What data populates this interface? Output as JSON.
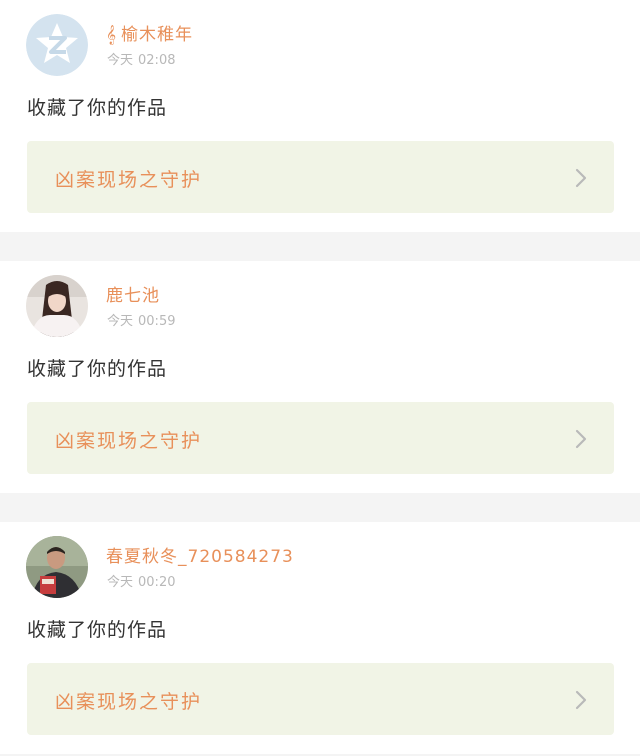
{
  "notifications": [
    {
      "user_prefix": "𝄞",
      "username": "榆木稚年",
      "time_day": "今天",
      "time_clock": "02:08",
      "action": "收藏了你的作品",
      "work_title": "凶案现场之守护",
      "avatar": "qq-default-avatar"
    },
    {
      "user_prefix": "",
      "username": "鹿七池",
      "time_day": "今天",
      "time_clock": "00:59",
      "action": "收藏了你的作品",
      "work_title": "凶案现场之守护",
      "avatar": "user-photo-avatar"
    },
    {
      "user_prefix": "",
      "username": "春夏秋冬_720584273",
      "time_day": "今天",
      "time_clock": "00:20",
      "action": "收藏了你的作品",
      "work_title": "凶案现场之守护",
      "avatar": "user-photo-avatar"
    }
  ],
  "colors": {
    "accent": "#e8905a",
    "card_link_bg": "#f1f4e6",
    "timestamp": "#b8b8b8",
    "separator": "#f4f4f4"
  }
}
